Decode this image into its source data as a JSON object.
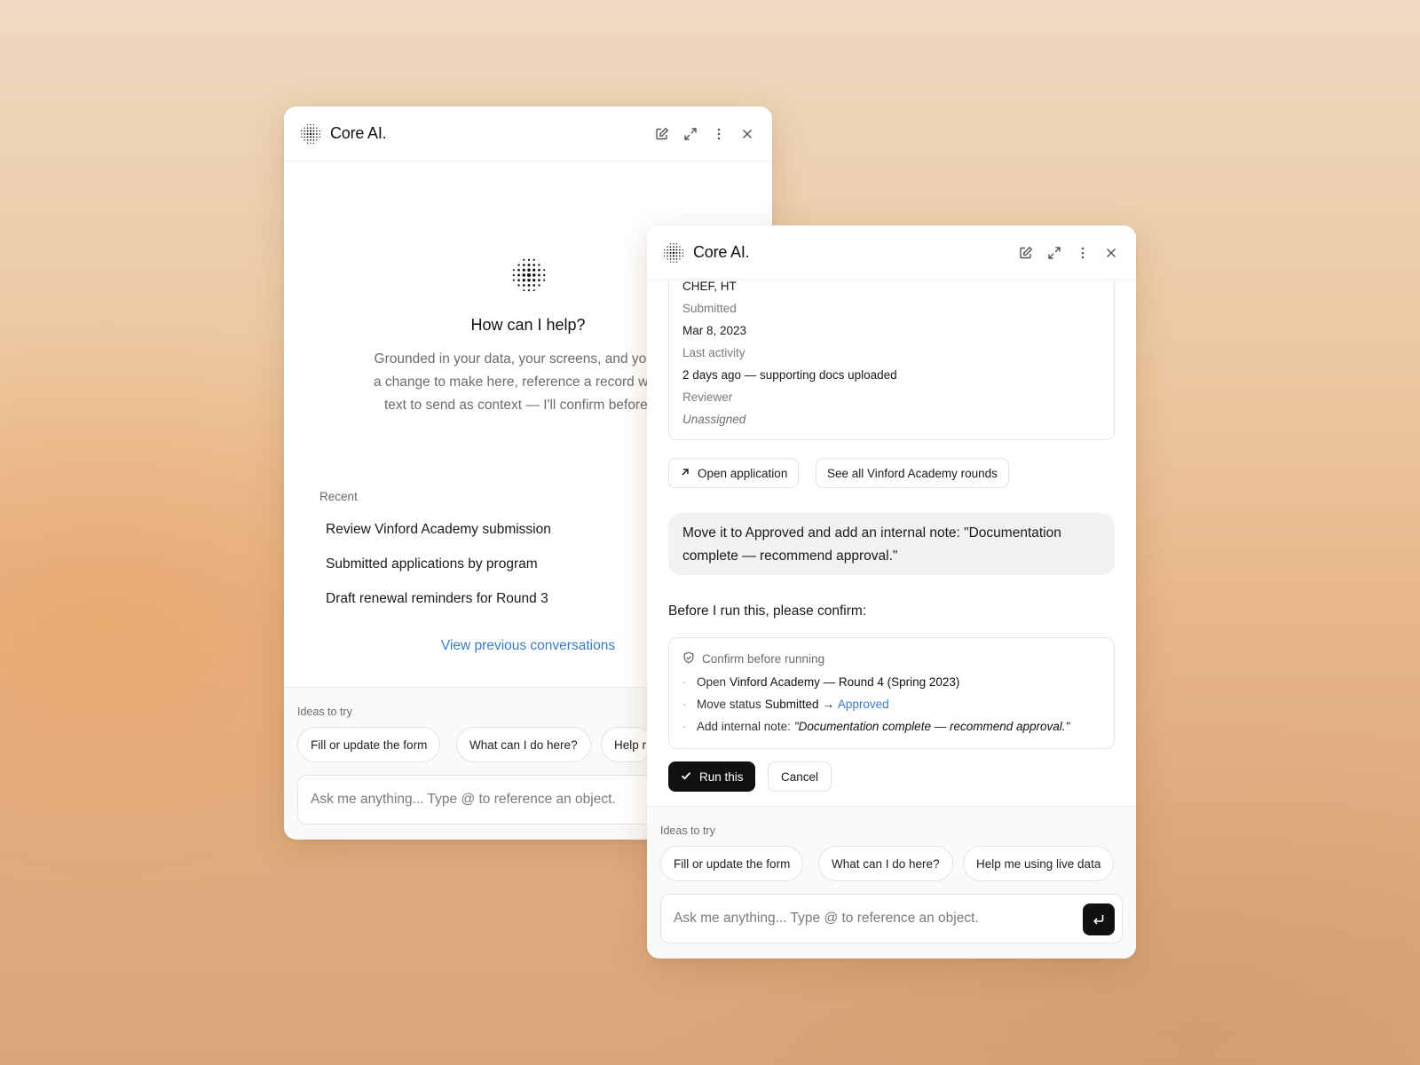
{
  "back_panel": {
    "title": "Core AI.",
    "help_title": "How can I help?",
    "help_lines": [
      "Grounded in your data, your screens, and your acti",
      "a change to make here, reference a record with @,",
      "text to send as context — I'll confirm before any"
    ],
    "recent_label": "Recent",
    "recent_items": [
      "Review Vinford Academy submission",
      "Submitted applications by program",
      "Draft renewal reminders for Round 3"
    ],
    "view_previous": "View previous conversations",
    "ideas_label": "Ideas to try",
    "ideas": [
      "Fill or update the form",
      "What can I do here?",
      "Help r"
    ],
    "ask_placeholder": "Ask me anything... Type @ to reference an object."
  },
  "front_panel": {
    "title": "Core AI.",
    "details": {
      "top_value": "CHEF, HT",
      "submitted_label": "Submitted",
      "submitted_value": "Mar 8, 2023",
      "last_activity_label": "Last activity",
      "last_activity_value": "2 days ago — supporting docs uploaded",
      "reviewer_label": "Reviewer",
      "reviewer_value": "Unassigned"
    },
    "actions": {
      "open_application": "Open application",
      "see_rounds": "See all Vinford Academy rounds"
    },
    "user_message": "Move it to Approved and add an internal note: \"Documentation complete — recommend approval.\"",
    "confirm_lead": "Before I run this, please confirm:",
    "confirm_card": {
      "header": "Confirm before running",
      "item1_prefix": "Open",
      "item1_strong": "Vinford Academy — Round 4 (Spring 2023)",
      "item2_prefix": "Move status",
      "item2_strong": "Submitted →",
      "item2_link": "Approved",
      "item3_prefix": "Add internal note:",
      "item3_italic": "\"Documentation complete — recommend approval.\""
    },
    "run_label": "Run this",
    "cancel_label": "Cancel",
    "ideas_label": "Ideas to try",
    "ideas": [
      "Fill or update the form",
      "What can I do here?",
      "Help me using live data"
    ],
    "ask_placeholder": "Ask me anything... Type @ to reference an object."
  },
  "colors": {
    "accent_link": "#3b7cc4",
    "primary_button": "#111111",
    "background_warm": "#e5b487"
  },
  "icons": {
    "logo": "dot-grid-logo-icon",
    "new_chat": "edit-icon",
    "expand": "expand-icon",
    "more": "more-vertical-icon",
    "close": "close-icon",
    "open_link": "arrow-up-right-icon",
    "shield": "shield-check-icon",
    "check": "check-icon",
    "send": "enter-return-icon"
  }
}
